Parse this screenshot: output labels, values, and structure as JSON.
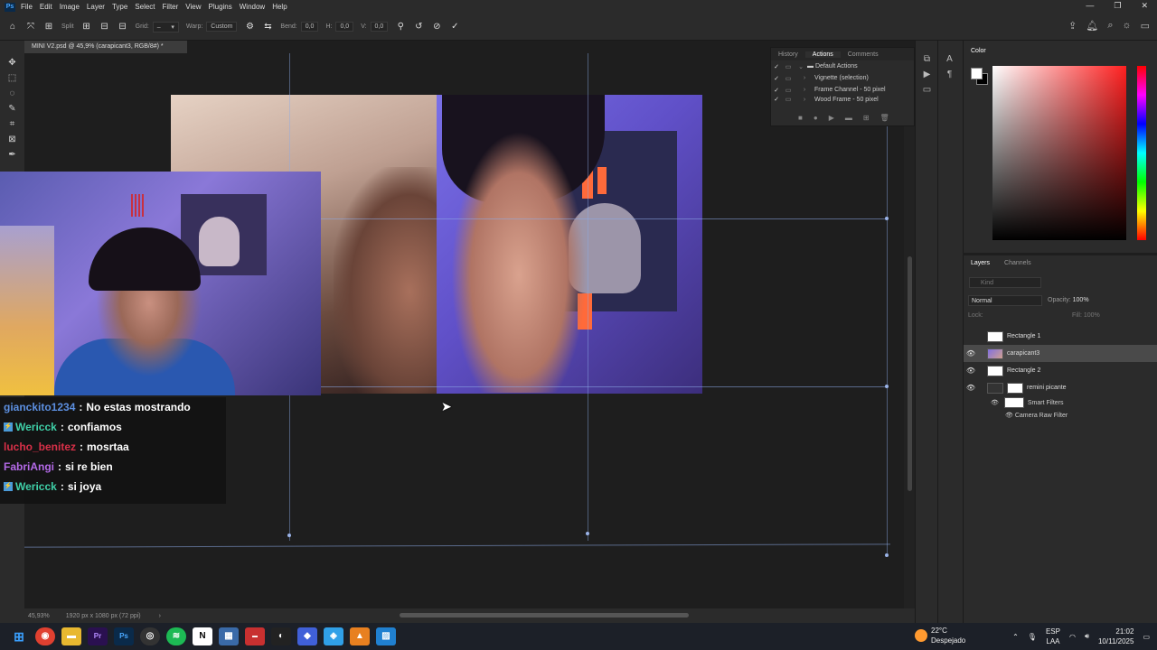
{
  "menubar": {
    "logo": "Ps",
    "items": [
      "File",
      "Edit",
      "Image",
      "Layer",
      "Type",
      "Select",
      "Filter",
      "View",
      "Plugins",
      "Window",
      "Help"
    ],
    "win_min": "—",
    "win_max": "❐",
    "win_close": "✕"
  },
  "options": {
    "split_label": "Split",
    "grid_label": "Grid:",
    "warp_label": "Warp:",
    "warp_value": "Custom",
    "bend_label": "Bend:",
    "bend_value": "0,0",
    "h_label": "H:",
    "h_value": "0,0",
    "v_label": "V:",
    "v_value": "0,0"
  },
  "document": {
    "tab_title": "MINI V2.psd @ 45,9% (carapicant3, RGB/8#) *",
    "zoom": "45,93%",
    "doc_size": "1920 px x 1080 px (72 ppi)"
  },
  "chat": {
    "messages": [
      {
        "user": "gianckito1234",
        "text": "No estas mostrando",
        "color": "#5c8fe0",
        "badge": false
      },
      {
        "user": "Wericck",
        "text": "confiamos",
        "color": "#3fd0a8",
        "badge": true
      },
      {
        "user": "lucho_benitez",
        "text": "mosrtaa",
        "color": "#d83048",
        "badge": false
      },
      {
        "user": "FabriAngi",
        "text": "si re bien",
        "color": "#b46ae8",
        "badge": false
      },
      {
        "user": "Wericck",
        "text": "si joya",
        "color": "#3fd0a8",
        "badge": true
      }
    ],
    "separator": ":"
  },
  "actions_panel": {
    "tabs": [
      "History",
      "Actions",
      "Comments"
    ],
    "active_tab": "Actions",
    "rows": [
      {
        "label": "Default Actions",
        "checked": true,
        "folder": true
      },
      {
        "label": "Vignette (selection)",
        "checked": true,
        "folder": false
      },
      {
        "label": "Frame Channel - 50 pixel",
        "checked": true,
        "folder": false
      },
      {
        "label": "Wood Frame - 50 pixel",
        "checked": true,
        "folder": false
      }
    ]
  },
  "color_panel": {
    "title": "Color",
    "foreground": "#ffffff",
    "background": "#000000"
  },
  "layers_panel": {
    "tabs": [
      "Layers",
      "Channels"
    ],
    "active_tab": "Layers",
    "search_placeholder": "Kind",
    "blend_mode": "Normal",
    "opacity_label": "Opacity:",
    "opacity_value": "100%",
    "lock_label": "Lock:",
    "fill_label": "Fill:",
    "fill_value": "100%",
    "layers": [
      {
        "name": "Rectangle 1",
        "visible": false,
        "selected": false
      },
      {
        "name": "carapicant3",
        "visible": true,
        "selected": true
      },
      {
        "name": "Rectangle 2",
        "visible": true,
        "selected": false
      },
      {
        "name": "remini picante",
        "visible": true,
        "selected": false
      }
    ],
    "sublayers": [
      "Smart Filters",
      "Camera Raw Filter"
    ]
  },
  "taskbar": {
    "weather_temp": "22°C",
    "weather_desc": "Despejado",
    "lang_top": "ESP",
    "lang_bottom": "LAA",
    "time": "21:02",
    "date": "10/11/2025"
  }
}
